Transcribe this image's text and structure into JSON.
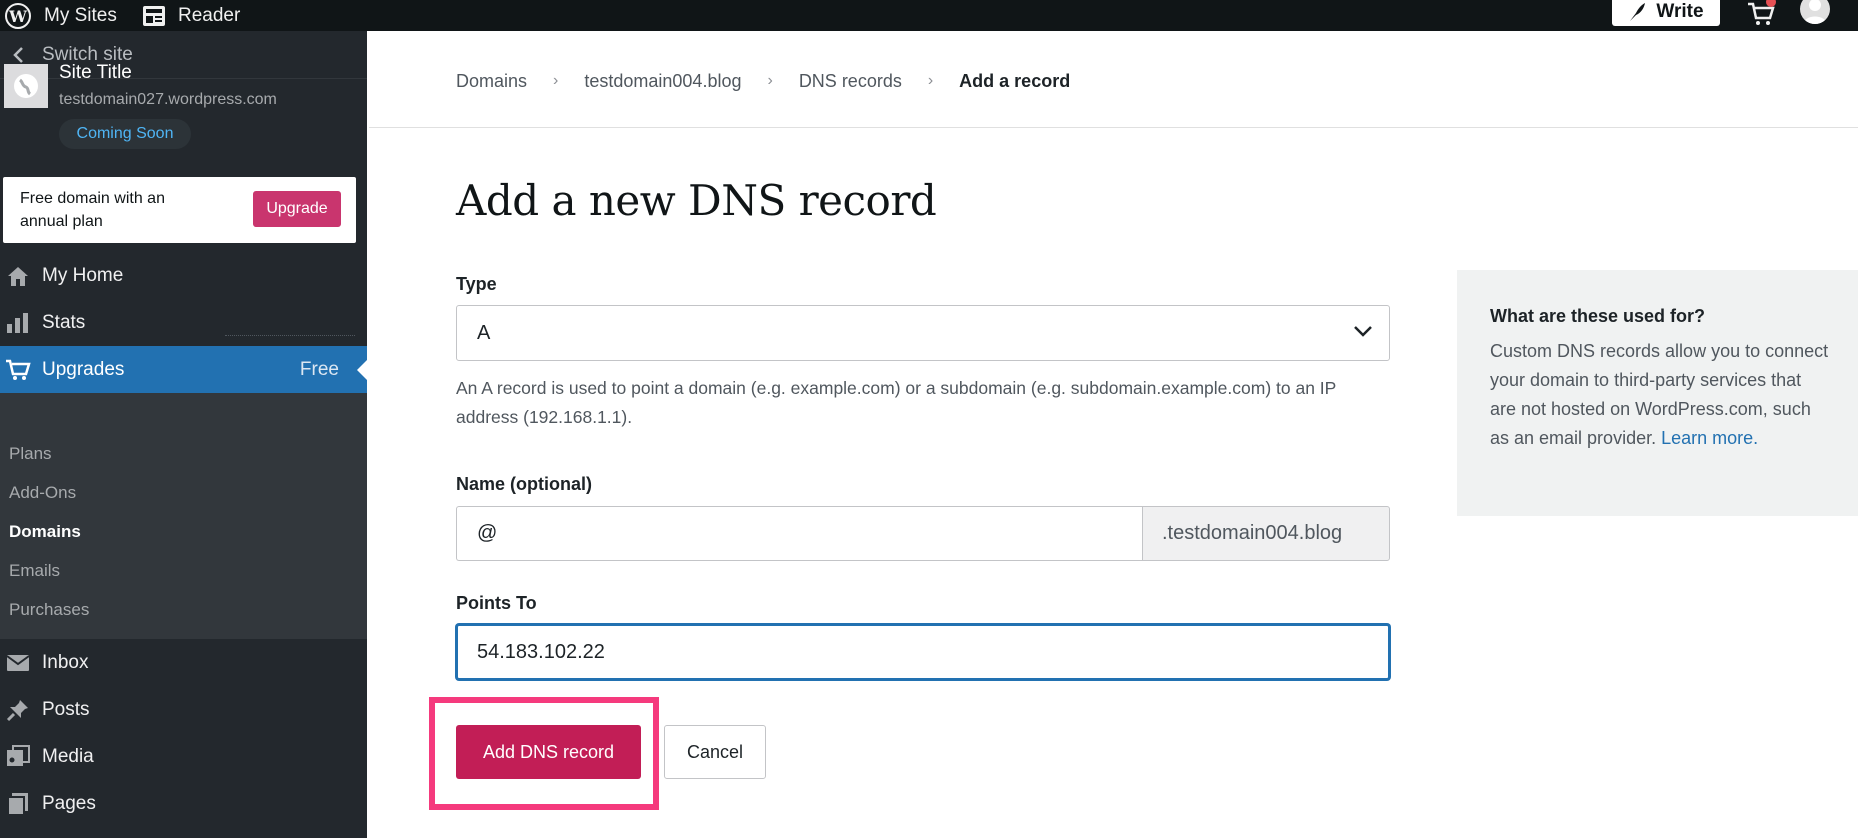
{
  "topbar": {
    "my_sites": "My Sites",
    "reader": "Reader",
    "write": "Write"
  },
  "sidebar": {
    "switch_site": "Switch site",
    "site_title": "Site Title",
    "site_url": "testdomain027.wordpress.com",
    "site_status": "Coming Soon",
    "promo_text": "Free domain with an annual plan",
    "promo_button": "Upgrade",
    "menu": {
      "my_home": "My Home",
      "stats": "Stats",
      "upgrades": "Upgrades",
      "upgrades_badge": "Free",
      "inbox": "Inbox",
      "posts": "Posts",
      "media": "Media",
      "pages": "Pages"
    },
    "submenu": [
      "Plans",
      "Add-Ons",
      "Domains",
      "Emails",
      "Purchases"
    ]
  },
  "breadcrumb": {
    "items": [
      "Domains",
      "testdomain004.blog",
      "DNS records"
    ],
    "current": "Add a record",
    "separator": "›"
  },
  "form": {
    "title": "Add a new DNS record",
    "type_label": "Type",
    "type_value": "A",
    "type_help": "An A record is used to point a domain (e.g. example.com) or a subdomain (e.g. subdomain.example.com) to an IP address (192.168.1.1).",
    "name_label": "Name (optional)",
    "name_value": "@",
    "name_suffix": ".testdomain004.blog",
    "points_label": "Points To",
    "points_value": "54.183.102.22",
    "submit": "Add DNS record",
    "cancel": "Cancel"
  },
  "info": {
    "title": "What are these used for?",
    "text": "Custom DNS records allow you to connect your domain to third-party services that are not hosted on WordPress.com, such as an email provider.",
    "link": "Learn more."
  },
  "colors": {
    "topbar": "#101517",
    "sidebar": "#23282d",
    "accent_blue": "#2271b1",
    "primary_button": "#c21e56",
    "highlight": "#f53a7d"
  }
}
